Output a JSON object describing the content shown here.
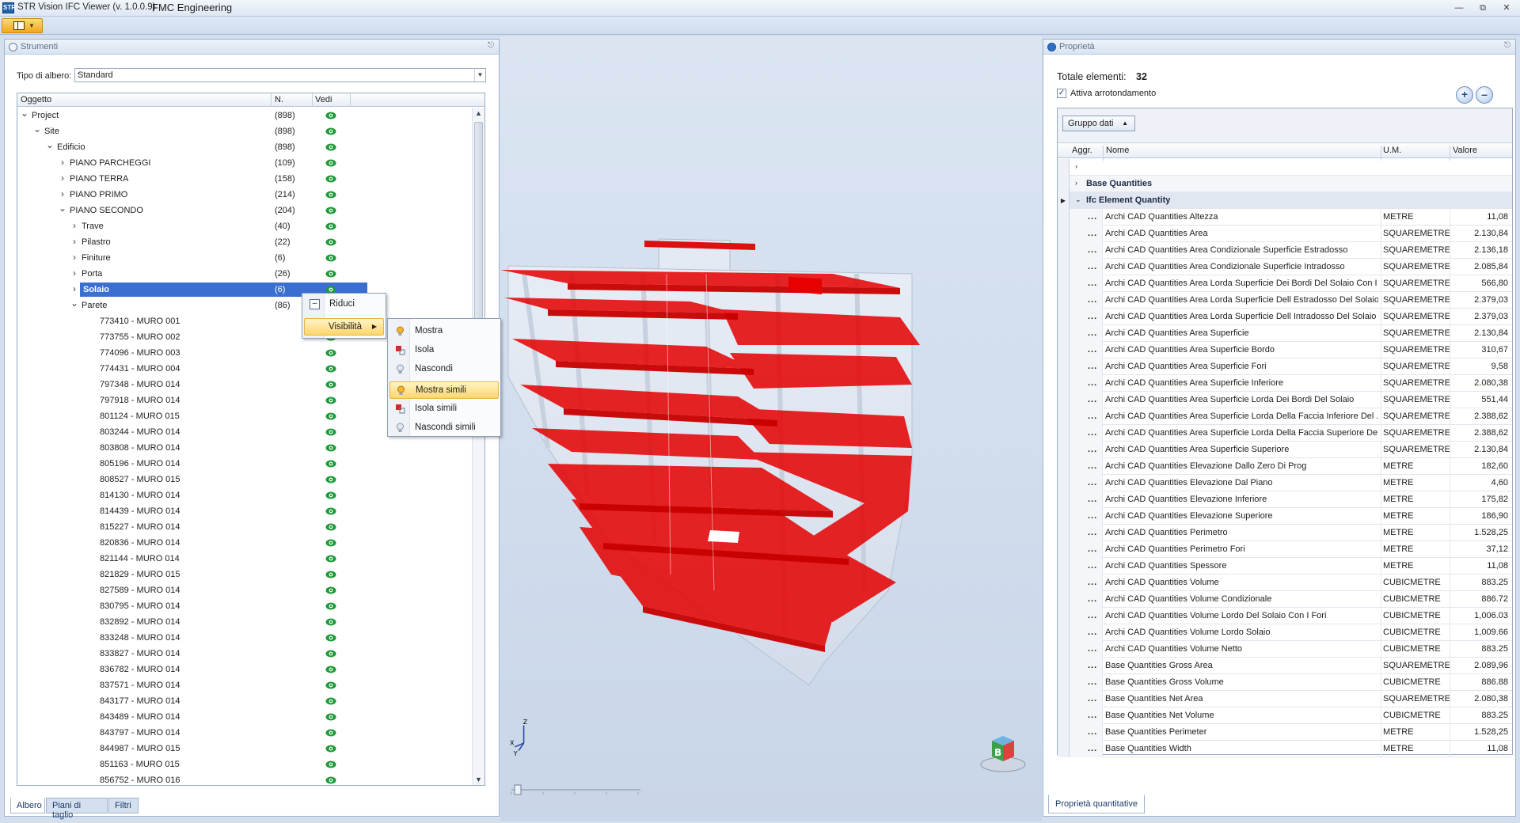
{
  "window": {
    "app_title": "STR Vision IFC Viewer (v. 1.0.0.9)",
    "company": "FMC Engineering",
    "app_icon": "STR"
  },
  "left_panel": {
    "title": "Strumenti",
    "tree_type_label": "Tipo di albero:",
    "tree_type_value": "Standard",
    "columns": [
      "Oggetto",
      "N.",
      "Vedi"
    ],
    "rows": [
      {
        "label": "Project",
        "count": "(898)",
        "level": 0,
        "expander": "expanded"
      },
      {
        "label": "Site",
        "count": "(898)",
        "level": 1,
        "expander": "expanded"
      },
      {
        "label": "Edificio",
        "count": "(898)",
        "level": 2,
        "expander": "expanded"
      },
      {
        "label": "PIANO PARCHEGGI",
        "count": "(109)",
        "level": 3,
        "expander": "collapsed"
      },
      {
        "label": "PIANO TERRA",
        "count": "(158)",
        "level": 3,
        "expander": "collapsed"
      },
      {
        "label": "PIANO PRIMO",
        "count": "(214)",
        "level": 3,
        "expander": "collapsed"
      },
      {
        "label": "PIANO SECONDO",
        "count": "(204)",
        "level": 3,
        "expander": "expanded"
      },
      {
        "label": "Trave",
        "count": "(40)",
        "level": 4,
        "expander": "collapsed"
      },
      {
        "label": "Pilastro",
        "count": "(22)",
        "level": 4,
        "expander": "collapsed"
      },
      {
        "label": "Finiture",
        "count": "(6)",
        "level": 4,
        "expander": "collapsed"
      },
      {
        "label": "Porta",
        "count": "(26)",
        "level": 4,
        "expander": "collapsed"
      },
      {
        "label": "Solaio",
        "count": "(6)",
        "level": 4,
        "expander": "collapsed",
        "selected": true
      },
      {
        "label": "Parete",
        "count": "(86)",
        "level": 4,
        "expander": "expanded"
      },
      {
        "label": "773410 - MURO 001",
        "count": "",
        "level": 5
      },
      {
        "label": "773755 - MURO 002",
        "count": "",
        "level": 5
      },
      {
        "label": "774096 - MURO 003",
        "count": "",
        "level": 5
      },
      {
        "label": "774431 - MURO 004",
        "count": "",
        "level": 5
      },
      {
        "label": "797348 - MURO 014",
        "count": "",
        "level": 5
      },
      {
        "label": "797918 - MURO 014",
        "count": "",
        "level": 5
      },
      {
        "label": "801124 - MURO 015",
        "count": "",
        "level": 5
      },
      {
        "label": "803244 - MURO 014",
        "count": "",
        "level": 5
      },
      {
        "label": "803808 - MURO 014",
        "count": "",
        "level": 5
      },
      {
        "label": "805196 - MURO 014",
        "count": "",
        "level": 5
      },
      {
        "label": "808527 - MURO 015",
        "count": "",
        "level": 5
      },
      {
        "label": "814130 - MURO 014",
        "count": "",
        "level": 5
      },
      {
        "label": "814439 - MURO 014",
        "count": "",
        "level": 5
      },
      {
        "label": "815227 - MURO 014",
        "count": "",
        "level": 5
      },
      {
        "label": "820836 - MURO 014",
        "count": "",
        "level": 5
      },
      {
        "label": "821144 - MURO 014",
        "count": "",
        "level": 5
      },
      {
        "label": "821829 - MURO 015",
        "count": "",
        "level": 5
      },
      {
        "label": "827589 - MURO 014",
        "count": "",
        "level": 5
      },
      {
        "label": "830795 - MURO 014",
        "count": "",
        "level": 5
      },
      {
        "label": "832892 - MURO 014",
        "count": "",
        "level": 5
      },
      {
        "label": "833248 - MURO 014",
        "count": "",
        "level": 5
      },
      {
        "label": "833827 - MURO 014",
        "count": "",
        "level": 5
      },
      {
        "label": "836782 - MURO 014",
        "count": "",
        "level": 5
      },
      {
        "label": "837571 - MURO 014",
        "count": "",
        "level": 5
      },
      {
        "label": "843177 - MURO 014",
        "count": "",
        "level": 5
      },
      {
        "label": "843489 - MURO 014",
        "count": "",
        "level": 5
      },
      {
        "label": "843797 - MURO 014",
        "count": "",
        "level": 5
      },
      {
        "label": "844987 - MURO 015",
        "count": "",
        "level": 5
      },
      {
        "label": "851163 - MURO 015",
        "count": "",
        "level": 5
      },
      {
        "label": "856752 - MURO 016",
        "count": "",
        "level": 5
      }
    ],
    "tabs": [
      "Albero",
      "Piani di taglio",
      "Filtri"
    ],
    "active_tab": "Albero",
    "eye_color": "#1f9a3a"
  },
  "context_menu": {
    "items": [
      "Riduci",
      "Visibilità"
    ],
    "highlighted": "Visibilità",
    "submenu": [
      "Mostra",
      "Isola",
      "Nascondi",
      "Mostra simili",
      "Isola simili",
      "Nascondi simili"
    ],
    "submenu_highlighted": "Mostra simili",
    "submenu_icons": [
      "bulb-on-icon",
      "isolate-icon",
      "bulb-off-icon",
      "bulb-on-icon",
      "isolate-icon",
      "bulb-off-icon"
    ]
  },
  "viewport": {
    "axis_labels": [
      "Z",
      "X",
      "Y"
    ],
    "navcube_label": "B",
    "model_highlight_color": "#e60000"
  },
  "right_panel": {
    "title": "Proprietà",
    "totals_label": "Totale elementi:",
    "totals_value": "32",
    "rounding_label": "Attiva arrotondamento",
    "rounding_checked": true,
    "group_button": "Gruppo dati",
    "columns": [
      "Aggr.",
      "Nome",
      "U.M.",
      "Valore"
    ],
    "groups": [
      "Base Quantities",
      "Ifc Element Quantity"
    ],
    "rows": [
      {
        "name": "Archi CAD Quantities Altezza",
        "um": "METRE",
        "value": "11,08"
      },
      {
        "name": "Archi CAD Quantities Area",
        "um": "SQUAREMETRE",
        "value": "2.130,84"
      },
      {
        "name": "Archi CAD Quantities Area Condizionale Superficie Estradosso",
        "um": "SQUAREMETRE",
        "value": "2.136,18"
      },
      {
        "name": "Archi CAD Quantities Area Condizionale Superficie Intradosso",
        "um": "SQUAREMETRE",
        "value": "2.085,84"
      },
      {
        "name": "Archi CAD Quantities Area Lorda Superficie Dei Bordi Del Solaio Con I ...",
        "um": "SQUAREMETRE",
        "value": "566,80"
      },
      {
        "name": "Archi CAD Quantities Area Lorda Superficie Dell Estradosso Del Solaio ...",
        "um": "SQUAREMETRE",
        "value": "2.379,03"
      },
      {
        "name": "Archi CAD Quantities Area Lorda Superficie Dell Intradosso Del Solaio ...",
        "um": "SQUAREMETRE",
        "value": "2.379,03"
      },
      {
        "name": "Archi CAD Quantities Area Superficie",
        "um": "SQUAREMETRE",
        "value": "2.130,84"
      },
      {
        "name": "Archi CAD Quantities Area Superficie Bordo",
        "um": "SQUAREMETRE",
        "value": "310,67"
      },
      {
        "name": "Archi CAD Quantities Area Superficie Fori",
        "um": "SQUAREMETRE",
        "value": "9,58"
      },
      {
        "name": "Archi CAD Quantities Area Superficie Inferiore",
        "um": "SQUAREMETRE",
        "value": "2.080,38"
      },
      {
        "name": "Archi CAD Quantities Area Superficie Lorda Dei Bordi Del Solaio",
        "um": "SQUAREMETRE",
        "value": "551,44"
      },
      {
        "name": "Archi CAD Quantities Area Superficie Lorda Della Faccia Inferiore Del ...",
        "um": "SQUAREMETRE",
        "value": "2.388,62"
      },
      {
        "name": "Archi CAD Quantities Area Superficie Lorda Della Faccia Superiore Del...",
        "um": "SQUAREMETRE",
        "value": "2.388,62"
      },
      {
        "name": "Archi CAD Quantities Area Superficie Superiore",
        "um": "SQUAREMETRE",
        "value": "2.130,84"
      },
      {
        "name": "Archi CAD Quantities Elevazione Dallo Zero Di Prog",
        "um": "METRE",
        "value": "182,60"
      },
      {
        "name": "Archi CAD Quantities Elevazione Dal Piano",
        "um": "METRE",
        "value": "4,60"
      },
      {
        "name": "Archi CAD Quantities Elevazione Inferiore",
        "um": "METRE",
        "value": "175,82"
      },
      {
        "name": "Archi CAD Quantities Elevazione Superiore",
        "um": "METRE",
        "value": "186,90"
      },
      {
        "name": "Archi CAD Quantities Perimetro",
        "um": "METRE",
        "value": "1.528,25"
      },
      {
        "name": "Archi CAD Quantities Perimetro Fori",
        "um": "METRE",
        "value": "37,12"
      },
      {
        "name": "Archi CAD Quantities Spessore",
        "um": "METRE",
        "value": "11,08"
      },
      {
        "name": "Archi CAD Quantities Volume",
        "um": "CUBICMETRE",
        "value": "883.25"
      },
      {
        "name": "Archi CAD Quantities Volume Condizionale",
        "um": "CUBICMETRE",
        "value": "886.72"
      },
      {
        "name": "Archi CAD Quantities Volume Lordo Del Solaio Con I Fori",
        "um": "CUBICMETRE",
        "value": "1,006.03"
      },
      {
        "name": "Archi CAD Quantities Volume Lordo Solaio",
        "um": "CUBICMETRE",
        "value": "1,009.66"
      },
      {
        "name": "Archi CAD Quantities Volume Netto",
        "um": "CUBICMETRE",
        "value": "883.25"
      },
      {
        "name": "Base Quantities Gross Area",
        "um": "SQUAREMETRE",
        "value": "2.089,96"
      },
      {
        "name": "Base Quantities Gross Volume",
        "um": "CUBICMETRE",
        "value": "886.88"
      },
      {
        "name": "Base Quantities Net Area",
        "um": "SQUAREMETRE",
        "value": "2.080,38"
      },
      {
        "name": "Base Quantities Net Volume",
        "um": "CUBICMETRE",
        "value": "883.25"
      },
      {
        "name": "Base Quantities Perimeter",
        "um": "METRE",
        "value": "1.528,25"
      },
      {
        "name": "Base Quantities Width",
        "um": "METRE",
        "value": "11,08"
      }
    ],
    "bottom_tab": "Proprietà quantitative"
  }
}
